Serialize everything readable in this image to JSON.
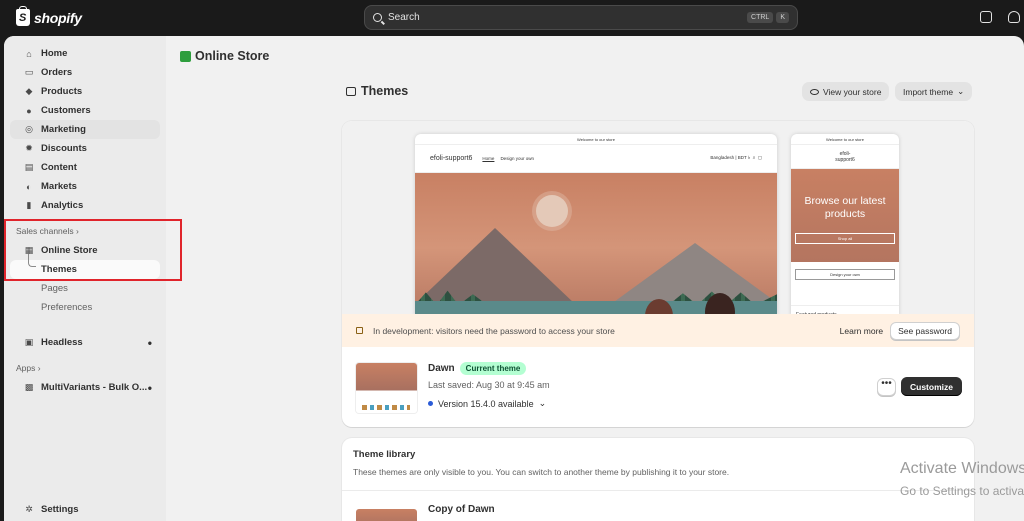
{
  "topbar": {
    "brand": "shopify",
    "search_placeholder": "Search",
    "shortcut_keys": [
      "CTRL",
      "K"
    ]
  },
  "sidebar": {
    "main_items": [
      {
        "label": "Home",
        "icon": "home-icon"
      },
      {
        "label": "Orders",
        "icon": "orders-icon"
      },
      {
        "label": "Products",
        "icon": "tag-icon"
      },
      {
        "label": "Customers",
        "icon": "person-icon"
      },
      {
        "label": "Marketing",
        "icon": "target-icon"
      },
      {
        "label": "Discounts",
        "icon": "discount-icon"
      },
      {
        "label": "Content",
        "icon": "content-icon"
      },
      {
        "label": "Markets",
        "icon": "globe-icon"
      },
      {
        "label": "Analytics",
        "icon": "chart-bars-icon"
      }
    ],
    "sales_channels_label": "Sales channels",
    "online_store": "Online Store",
    "sub_items": [
      "Themes",
      "Pages",
      "Preferences"
    ],
    "headless": "Headless",
    "apps_label": "Apps",
    "app_item": "MultiVariants - Bulk O...",
    "settings": "Settings",
    "highlight_color": "#e0242b"
  },
  "main": {
    "page_title": "Online Store",
    "section_title": "Themes",
    "view_store_btn": "View your store",
    "import_theme_btn": "Import theme",
    "preview": {
      "announcement": "Welcome to our store",
      "store_name": "efoli-support6",
      "nav_home": "Home",
      "nav_design": "Design your own",
      "locale": "Bangladesh | BDT ৳",
      "mobile_store_name": "efoli-support6",
      "mobile_hero_title": "Browse our latest products",
      "mobile_shop_btn": "Shop all",
      "mobile_design_btn": "Design your own",
      "mobile_featured": "Featured products"
    },
    "dev_banner": {
      "text": "In development: visitors need the password to access your store",
      "learn_more": "Learn more",
      "see_password": "See password"
    },
    "current_theme": {
      "name": "Dawn",
      "badge": "Current theme",
      "last_saved": "Last saved: Aug 30 at 9:45 am",
      "version": "Version 15.4.0 available",
      "more_btn": "•••",
      "customize_btn": "Customize"
    },
    "library": {
      "title": "Theme library",
      "subtitle": "These themes are only visible to you. You can switch to another theme by publishing it to your store.",
      "first_theme": "Copy of Dawn"
    }
  },
  "watermark": {
    "line1": "Activate Windows",
    "line2": "Go to Settings to activate Windows."
  }
}
